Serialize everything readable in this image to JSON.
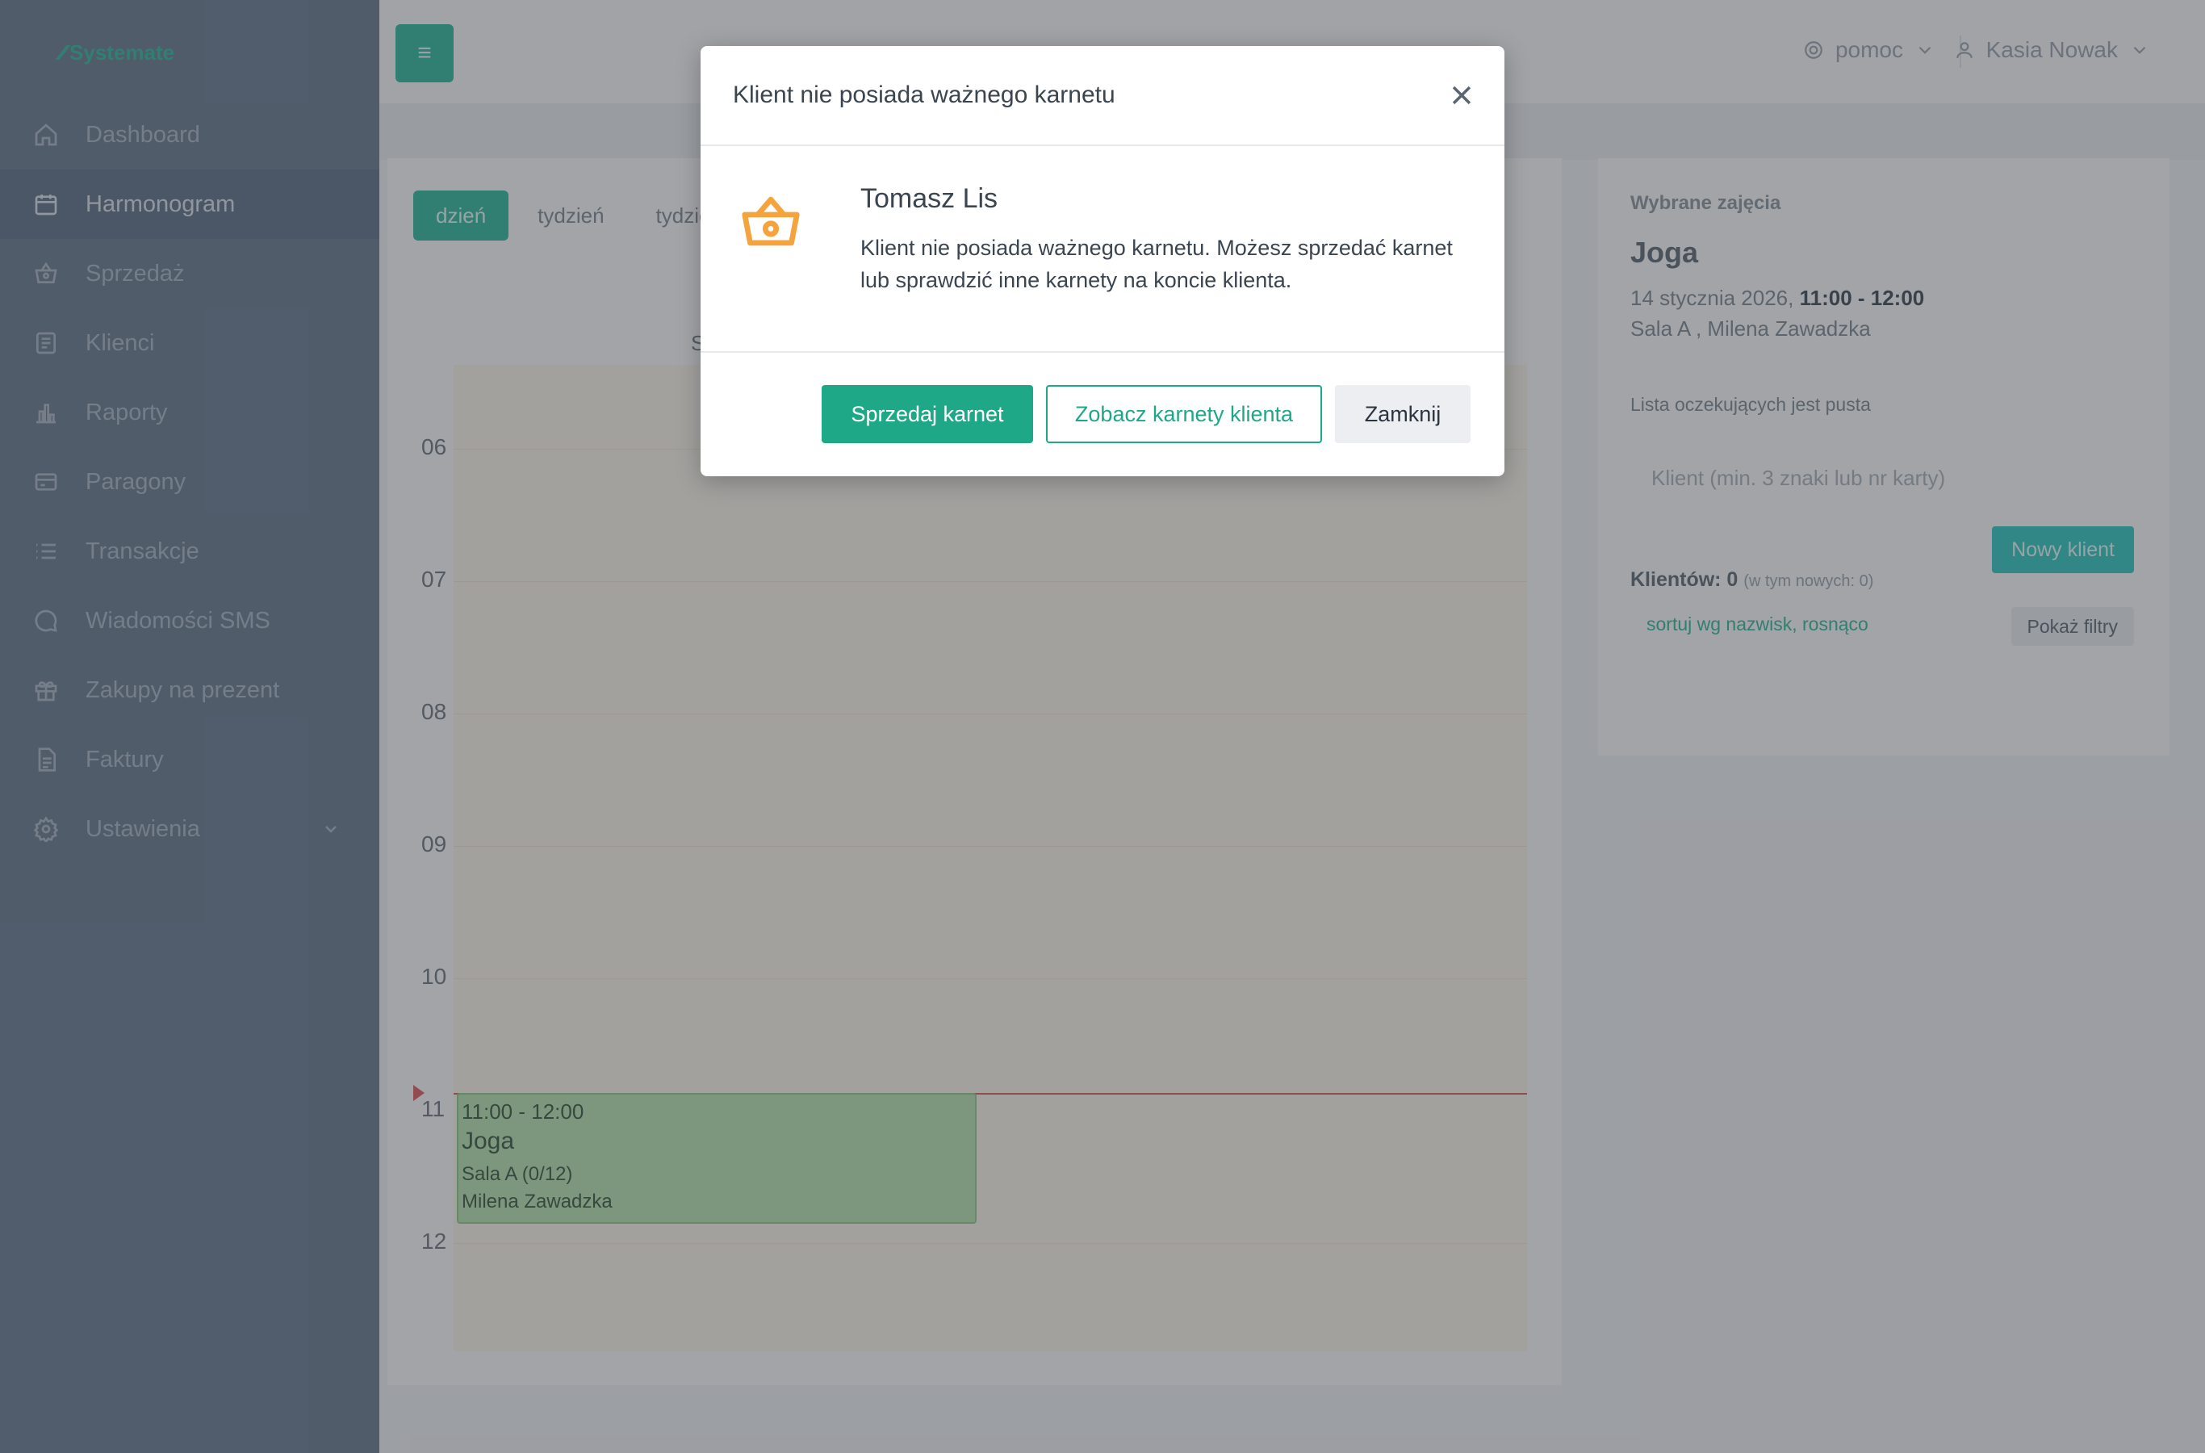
{
  "app": {
    "logo_text": "Systemate"
  },
  "sidebar": {
    "items": [
      {
        "label": "Dashboard",
        "icon": "home-icon"
      },
      {
        "label": "Harmonogram",
        "icon": "calendar-icon"
      },
      {
        "label": "Sprzedaż",
        "icon": "basket-icon"
      },
      {
        "label": "Klienci",
        "icon": "id-card-icon"
      },
      {
        "label": "Raporty",
        "icon": "bar-chart-icon"
      },
      {
        "label": "Paragony",
        "icon": "receipt-icon"
      },
      {
        "label": "Transakcje",
        "icon": "list-icon"
      },
      {
        "label": "Wiadomości SMS",
        "icon": "chat-icon"
      },
      {
        "label": "Zakupy na prezent",
        "icon": "gift-icon"
      },
      {
        "label": "Faktury",
        "icon": "document-icon"
      },
      {
        "label": "Ustawienia",
        "icon": "gear-icon"
      }
    ]
  },
  "header": {
    "help_label": "pomoc",
    "user_name": "Kasia Nowak"
  },
  "calendar": {
    "views": [
      "dzień",
      "tydzień",
      "tydzień"
    ],
    "column_header": "S",
    "hours": [
      "06",
      "07",
      "08",
      "09",
      "10",
      "11",
      "12"
    ],
    "event": {
      "time": "11:00 - 12:00",
      "title": "Joga",
      "room": "Sala A (0/12)",
      "instructor": "Milena Zawadzka"
    }
  },
  "selected_class": {
    "label": "Wybrane zajęcia",
    "title": "Joga",
    "date": "14 stycznia 2026,",
    "time": "11:00 - 12:00",
    "room": "Sala A , Milena Zawadzka",
    "waitlist": "Lista oczekujących jest pusta",
    "client_placeholder": "Klient (min. 3 znaki lub nr karty)",
    "new_client_label": "Nowy klient",
    "clients_count": "Klientów: 0",
    "clients_new": "(w tym nowych: 0)",
    "sort_label": "sortuj wg nazwisk, rosnąco",
    "filters_label": "Pokaż filtry"
  },
  "modal": {
    "title": "Klient nie posiada ważnego karnetu",
    "client_name": "Tomasz Lis",
    "message": "Klient nie posiada ważnego karnetu. Możesz sprzedać karnet lub sprawdzić inne karnety na koncie klienta.",
    "sell_label": "Sprzedaj karnet",
    "view_label": "Zobacz karnety klienta",
    "close_label": "Zamknij",
    "icon": "basket-icon"
  },
  "colors": {
    "accent": "#1fa888",
    "warning_icon": "#f5a33c",
    "event_bg": "#b8e7b1",
    "now_line": "#e15a5a"
  }
}
